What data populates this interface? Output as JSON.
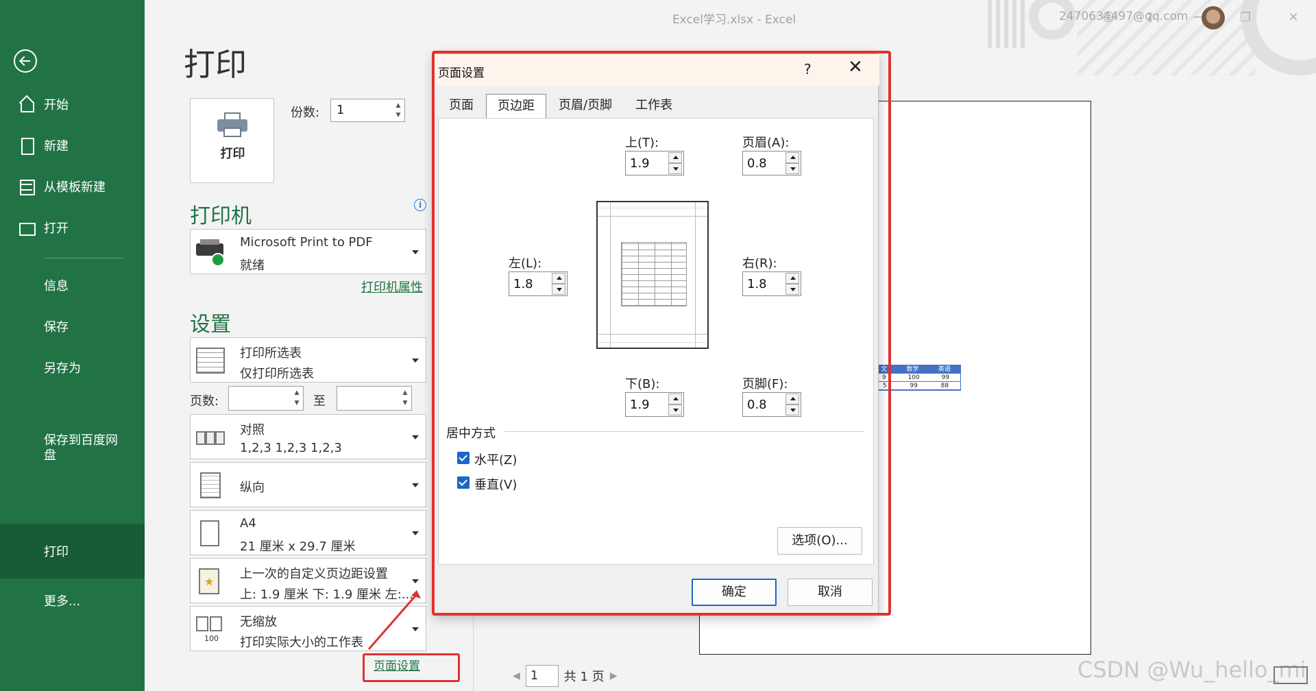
{
  "window": {
    "title": "Excel学习.xlsx  -  Excel",
    "user_email": "2470634497@qq.com"
  },
  "sidebar": {
    "items": [
      {
        "label": "开始",
        "icon": "home-icon"
      },
      {
        "label": "新建",
        "icon": "new-document-icon"
      },
      {
        "label": "从模板新建",
        "icon": "template-icon"
      },
      {
        "label": "打开",
        "icon": "open-folder-icon"
      },
      {
        "label": "信息"
      },
      {
        "label": "保存"
      },
      {
        "label": "另存为"
      },
      {
        "label": "保存到百度网盘"
      },
      {
        "label": "打印"
      },
      {
        "label": "更多..."
      }
    ],
    "active": "打印"
  },
  "print": {
    "heading": "打印",
    "print_button": "打印",
    "copies_label": "份数:",
    "copies_value": "1",
    "printer_section": "打印机",
    "printer_name": "Microsoft Print to PDF",
    "printer_status": "就绪",
    "printer_properties": "打印机属性",
    "settings_section": "设置",
    "pages_label": "页数:",
    "pages_to": "至",
    "settings": [
      {
        "line1": "打印所选表",
        "line2": "仅打印所选表"
      },
      {
        "line1": "对照",
        "line2": "1,2,3    1,2,3    1,2,3"
      },
      {
        "line1": "纵向",
        "line2": ""
      },
      {
        "line1": "A4",
        "line2": "21 厘米 x 29.7 厘米"
      },
      {
        "line1": "上一次的自定义页边距设置",
        "line2": "上: 1.9 厘米 下: 1.9 厘米 左:..."
      },
      {
        "line1": "无缩放",
        "line2": "打印实际大小的工作表"
      }
    ],
    "page_setup_link": "页面设置"
  },
  "preview": {
    "table_headers": [
      "文",
      "数学",
      "英语"
    ],
    "table_rows": [
      [
        "9",
        "100",
        "99"
      ],
      [
        "5",
        "99",
        "88"
      ]
    ],
    "pager_value": "1",
    "pager_total": "共 1 页",
    "watermark": "CSDN @Wu_hello_mi"
  },
  "dialog": {
    "title": "页面设置",
    "help": "?",
    "close": "✕",
    "tabs": [
      "页面",
      "页边距",
      "页眉/页脚",
      "工作表"
    ],
    "active_tab": "页边距",
    "margins": {
      "top": {
        "label": "上(T):",
        "value": "1.9"
      },
      "header": {
        "label": "页眉(A):",
        "value": "0.8"
      },
      "left": {
        "label": "左(L):",
        "value": "1.8"
      },
      "right": {
        "label": "右(R):",
        "value": "1.8"
      },
      "bottom": {
        "label": "下(B):",
        "value": "1.9"
      },
      "footer": {
        "label": "页脚(F):",
        "value": "0.8"
      }
    },
    "center_on_page": "居中方式",
    "horizontal": "水平(Z)",
    "vertical": "垂直(V)",
    "horizontal_checked": true,
    "vertical_checked": true,
    "options_button": "选项(O)...",
    "ok": "确定",
    "cancel": "取消"
  },
  "colors": {
    "sidebar": "#217346",
    "sidebar_active": "#185c37",
    "highlight": "#e03131",
    "accent_blue": "#1967c6"
  }
}
